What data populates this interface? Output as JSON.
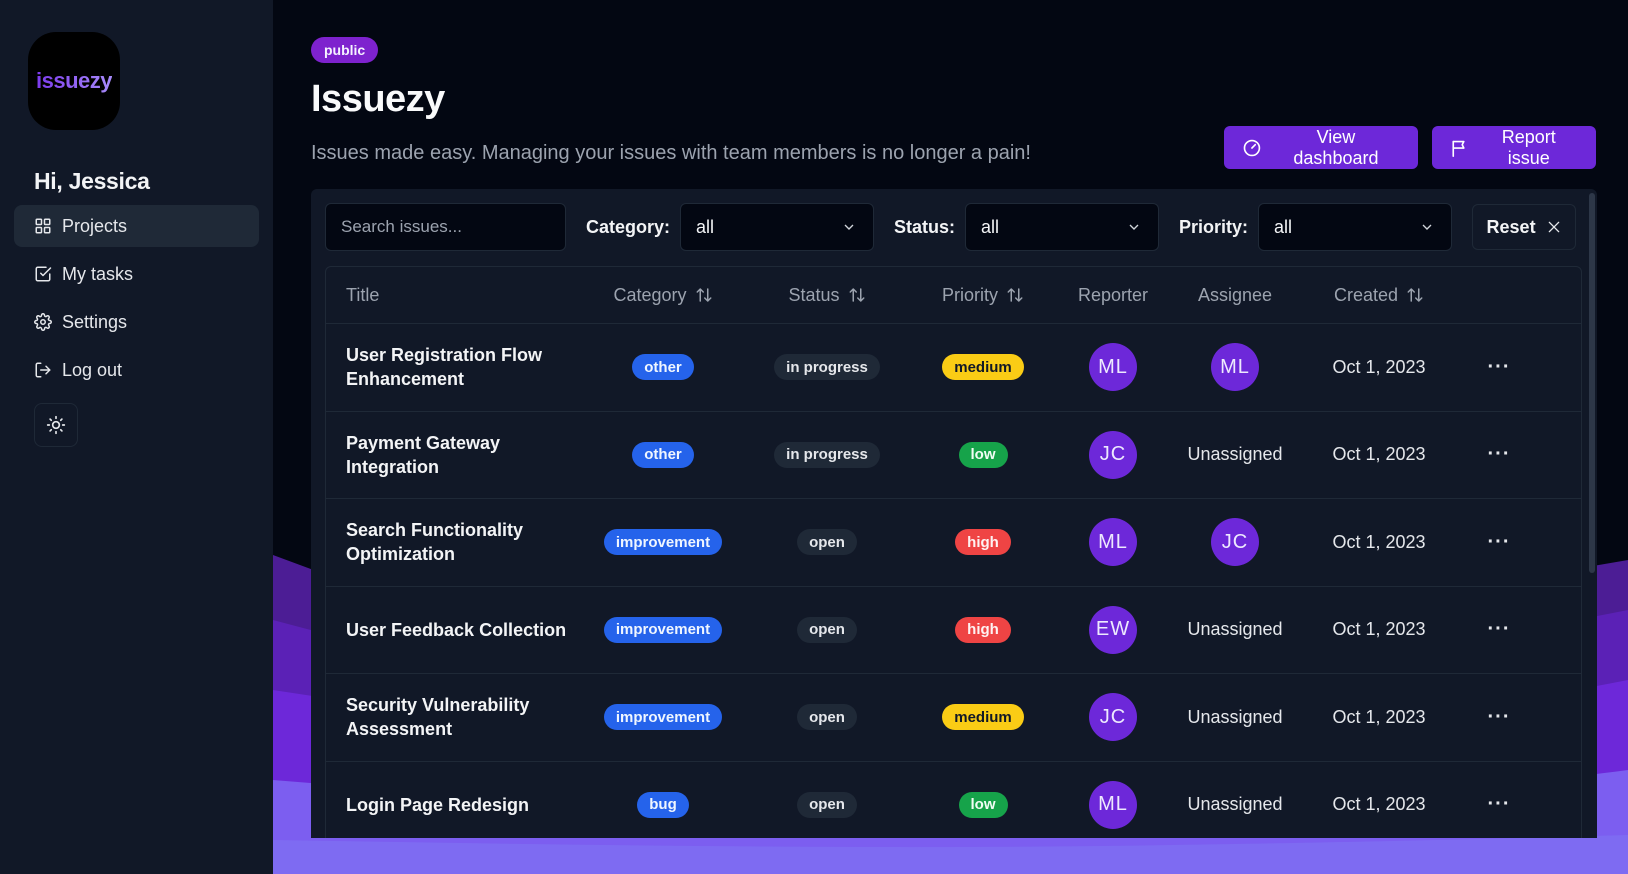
{
  "app": {
    "logo_text": "issuezy"
  },
  "sidebar": {
    "greeting": "Hi, Jessica",
    "items": [
      {
        "label": "Projects",
        "icon": "grid-icon",
        "active": true
      },
      {
        "label": "My tasks",
        "icon": "checkbox-icon",
        "active": false
      },
      {
        "label": "Settings",
        "icon": "gear-icon",
        "active": false
      },
      {
        "label": "Log out",
        "icon": "logout-icon",
        "active": false
      }
    ],
    "theme_toggle_icon": "sun-icon"
  },
  "header": {
    "badge": "public",
    "title": "Issuezy",
    "subtitle": "Issues made easy. Managing your issues with team members is no longer a pain!",
    "view_dashboard_label": "View dashboard",
    "report_issue_label": "Report issue"
  },
  "filters": {
    "search_placeholder": "Search issues...",
    "category_label": "Category:",
    "category_value": "all",
    "status_label": "Status:",
    "status_value": "all",
    "priority_label": "Priority:",
    "priority_value": "all",
    "reset_label": "Reset"
  },
  "table": {
    "columns": {
      "title": "Title",
      "category": "Category",
      "status": "Status",
      "priority": "Priority",
      "reporter": "Reporter",
      "assignee": "Assignee",
      "created": "Created"
    },
    "rows": [
      {
        "title": "User Registration Flow Enhancement",
        "category": "other",
        "status": "in progress",
        "priority": "medium",
        "reporter": "ML",
        "assignee": "ML",
        "assignee_is_avatar": true,
        "created": "Oct 1, 2023"
      },
      {
        "title": "Payment Gateway Integration",
        "category": "other",
        "status": "in progress",
        "priority": "low",
        "reporter": "JC",
        "assignee": "Unassigned",
        "assignee_is_avatar": false,
        "created": "Oct 1, 2023"
      },
      {
        "title": "Search Functionality Optimization",
        "category": "improvement",
        "status": "open",
        "priority": "high",
        "reporter": "ML",
        "assignee": "JC",
        "assignee_is_avatar": true,
        "created": "Oct 1, 2023"
      },
      {
        "title": "User Feedback Collection",
        "category": "improvement",
        "status": "open",
        "priority": "high",
        "reporter": "EW",
        "assignee": "Unassigned",
        "assignee_is_avatar": false,
        "created": "Oct 1, 2023"
      },
      {
        "title": "Security Vulnerability Assessment",
        "category": "improvement",
        "status": "open",
        "priority": "medium",
        "reporter": "JC",
        "assignee": "Unassigned",
        "assignee_is_avatar": false,
        "created": "Oct 1, 2023"
      },
      {
        "title": "Login Page Redesign",
        "category": "bug",
        "status": "open",
        "priority": "low",
        "reporter": "ML",
        "assignee": "Unassigned",
        "assignee_is_avatar": false,
        "created": "Oct 1, 2023"
      }
    ]
  },
  "colors": {
    "accent": "#6d28d9",
    "category": "#2563eb",
    "status": "#1f2937",
    "priority_medium": "#facc15",
    "priority_low": "#16a34a",
    "priority_high": "#ef4444"
  }
}
